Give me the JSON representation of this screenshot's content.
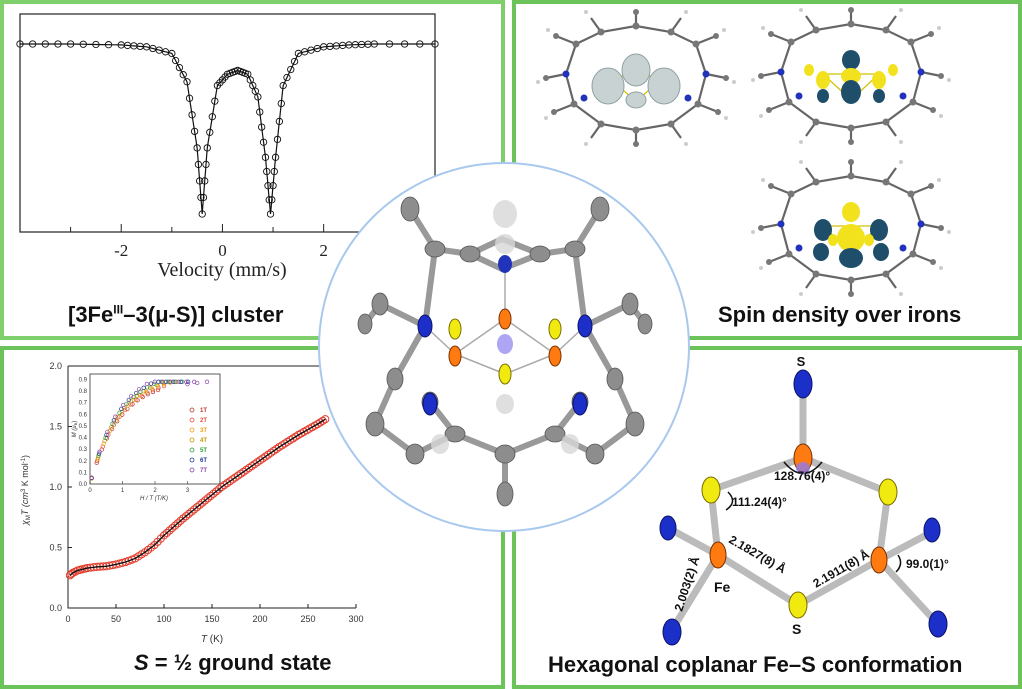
{
  "captions": {
    "mossbauer": "[3Fe",
    "mossbauer_sup": "III",
    "mossbauer_tail": "–3(μ-S)] cluster",
    "spin": "Spin density over irons",
    "ground_prefix": "S",
    "ground_tail": " = ½ ground state",
    "hexagon": "Hexagonal coplanar Fe–S conformation"
  },
  "mossbauer_plot": {
    "xlabel": "Velocity (mm/s)",
    "xticks": [
      "-2",
      "0",
      "2"
    ],
    "xtick_values": [
      -2,
      0,
      2
    ],
    "xlim": [
      -4.0,
      4.2
    ]
  },
  "magnet_plot": {
    "ylabel_main": "χ",
    "ylabel_sub": "M",
    "ylabel_tail": "T (cm",
    "ylabel_sup": "3",
    "ylabel_end": " K mol",
    "ylabel_sup2": "-1",
    "ylabel_close": ")",
    "xlabel": "T",
    "xlabel_unit": " (K)",
    "xticks": [
      "0",
      "50",
      "100",
      "150",
      "200",
      "250",
      "300"
    ],
    "yticks": [
      "0.0",
      "0.5",
      "1.0",
      "1.5",
      "2.0"
    ],
    "xlim": [
      0,
      300
    ],
    "ylim": [
      0,
      2.0
    ],
    "inset": {
      "ylabel": "M (μ",
      "ylabel_sub": "B",
      "ylabel_close": ")",
      "xlabel": "H / T (T/K)",
      "yticks": [
        "0.0",
        "0.1",
        "0.2",
        "0.3",
        "0.4",
        "0.5",
        "0.6",
        "0.7",
        "0.8",
        "0.9"
      ],
      "xticks": [
        "0",
        "1",
        "2",
        "3",
        "4"
      ],
      "legend": [
        "1T",
        "2T",
        "3T",
        "4T",
        "5T",
        "6T",
        "7T"
      ],
      "legend_colors": [
        "#c0392b",
        "#e74c3c",
        "#f39c12",
        "#c49a00",
        "#2e9c3a",
        "#1f3a93",
        "#8e44ad"
      ]
    }
  },
  "hexagon_labels": {
    "angle_top": "128.76(4)°",
    "angle_left": "111.24(4)°",
    "angle_right": "99.0(1)°",
    "bond1": "2.003(2) Å",
    "bond2": "2.1827(8) Å",
    "bond3": "2.1911(8) Å",
    "atom_fe": "Fe",
    "atom_s": "S",
    "atom_s_top": "S"
  },
  "chart_data": [
    {
      "type": "line",
      "title": "",
      "xlabel": "Velocity (mm/s)",
      "ylabel": "",
      "xlim": [
        -4.0,
        4.2
      ],
      "series": [
        {
          "x": [
            -4.0,
            -3.0,
            -2.0,
            -1.5,
            -1.0,
            -0.7,
            -0.5,
            -0.4,
            -0.3,
            -0.1,
            0.1,
            0.3,
            0.5,
            0.7,
            0.85,
            0.95,
            1.05,
            1.2,
            1.5,
            2.0,
            2.5,
            3.0,
            4.2
          ],
          "values": [
            1.0,
            1.0,
            0.995,
            0.985,
            0.95,
            0.8,
            0.45,
            0.1,
            0.45,
            0.78,
            0.84,
            0.86,
            0.84,
            0.72,
            0.4,
            0.1,
            0.4,
            0.78,
            0.95,
            0.985,
            0.995,
            1.0,
            1.0
          ]
        }
      ]
    },
    {
      "type": "scatter",
      "title": "",
      "xlabel": "T (K)",
      "ylabel": "χMT (cm3 K mol-1)",
      "xlim": [
        0,
        300
      ],
      "ylim": [
        0,
        2.0
      ],
      "series": [
        {
          "x": [
            2,
            5,
            10,
            15,
            20,
            30,
            40,
            50,
            60,
            70,
            80,
            90,
            100,
            120,
            140,
            160,
            180,
            200,
            220,
            240,
            260,
            268
          ],
          "values": [
            0.27,
            0.29,
            0.31,
            0.32,
            0.33,
            0.34,
            0.345,
            0.36,
            0.38,
            0.41,
            0.46,
            0.52,
            0.6,
            0.74,
            0.87,
            1.0,
            1.11,
            1.22,
            1.33,
            1.43,
            1.52,
            1.56
          ]
        }
      ]
    }
  ]
}
